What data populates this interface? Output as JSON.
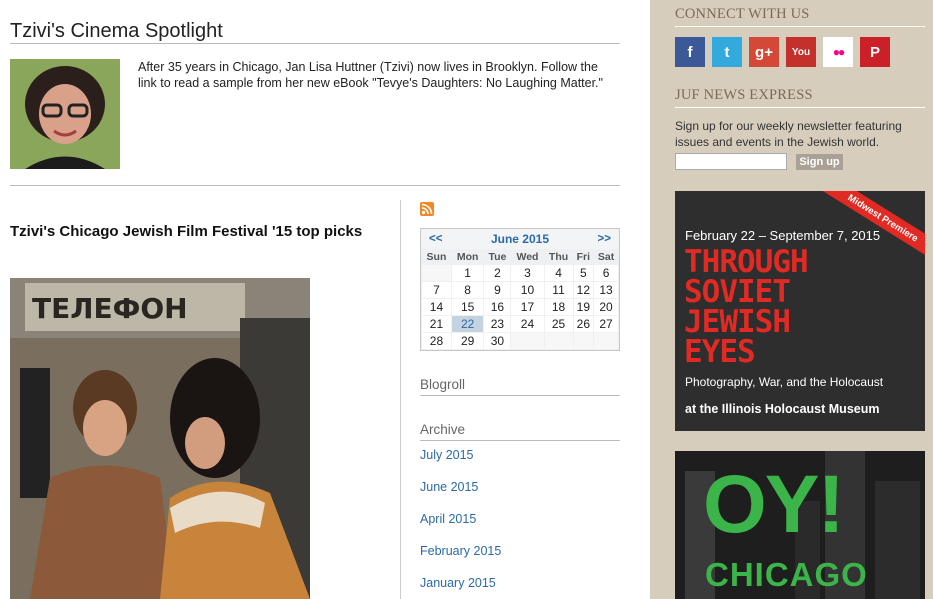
{
  "blog": {
    "title": "Tzivi's Cinema Spotlight",
    "bio": "After 35 years in Chicago, Jan Lisa Huttner (Tzivi) now lives in Brooklyn. Follow the link to read a sample from her new eBook \"Tevye's Daughters: No Laughing Matter.\""
  },
  "post": {
    "title": "Tzivi's Chicago Jewish Film Festival '15 top picks",
    "image_sign_text": "ТЕЛЕФОН"
  },
  "calendar": {
    "prev": "<<",
    "next": ">>",
    "month": "June 2015",
    "weekdays": [
      "Sun",
      "Mon",
      "Tue",
      "Wed",
      "Thu",
      "Fri",
      "Sat"
    ],
    "weeks": [
      [
        "",
        "1",
        "2",
        "3",
        "4",
        "5",
        "6"
      ],
      [
        "7",
        "8",
        "9",
        "10",
        "11",
        "12",
        "13"
      ],
      [
        "14",
        "15",
        "16",
        "17",
        "18",
        "19",
        "20"
      ],
      [
        "21",
        "22",
        "23",
        "24",
        "25",
        "26",
        "27"
      ],
      [
        "28",
        "29",
        "30",
        "",
        "",
        "",
        ""
      ]
    ],
    "today": "22"
  },
  "widgets": {
    "blogroll": "Blogroll",
    "archive": "Archive",
    "archive_items": [
      "July 2015",
      "June 2015",
      "April 2015",
      "February 2015",
      "January 2015"
    ]
  },
  "sidebar": {
    "connect_title": "CONNECT WITH US",
    "social": [
      {
        "icon": "facebook-icon",
        "glyph": "f",
        "color": "#3b5998"
      },
      {
        "icon": "twitter-icon",
        "glyph": "t",
        "color": "#33aadd"
      },
      {
        "icon": "googleplus-icon",
        "glyph": "g+",
        "color": "#d34836"
      },
      {
        "icon": "youtube-icon",
        "glyph": "You",
        "color": "#c4302b"
      },
      {
        "icon": "flickr-icon",
        "glyph": "●●",
        "color": "#ffffff"
      },
      {
        "icon": "pinterest-icon",
        "glyph": "P",
        "color": "#cb2027"
      }
    ],
    "juf_title": "JUF NEWS EXPRESS",
    "newsletter_text": "Sign up for our weekly newsletter featuring issues and events in the Jewish world.",
    "signup_label": "Sign up",
    "ad1": {
      "ribbon": "Midwest Premiere",
      "dates": "February 22 – September 7, 2015",
      "headline": [
        "THROUGH",
        "SOVIET",
        "JEWISH",
        "EYES"
      ],
      "subtitle": "Photography, War, and the Holocaust",
      "venue": "at the Illinois Holocaust Museum"
    },
    "ad2": {
      "logo": "OY!",
      "city": "CHICAGO"
    }
  }
}
